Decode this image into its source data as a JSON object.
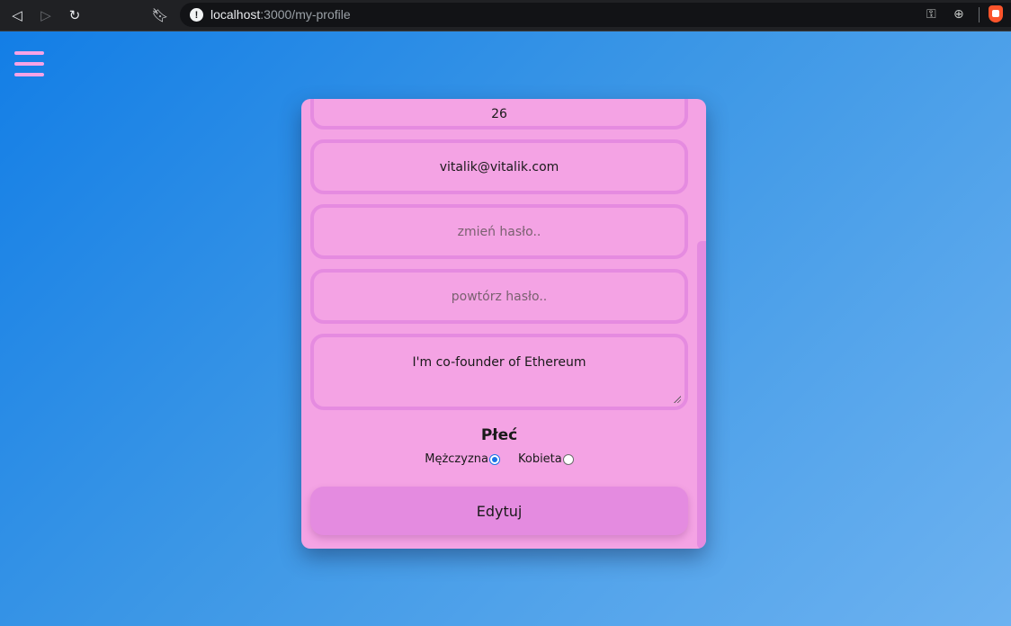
{
  "browser": {
    "url_host": "localhost",
    "url_path": ":3000/my-profile",
    "info_icon": "!"
  },
  "menu": {
    "icon": "hamburger-icon"
  },
  "profile_form": {
    "age_value": "26",
    "email_value": "vitalik@vitalik.com",
    "password_placeholder": "zmień hasło..",
    "repeat_password_placeholder": "powtórz hasło..",
    "bio_value": "I'm co-founder of Ethereum",
    "gender_title": "Płeć",
    "gender_options": [
      {
        "label": "Mężczyzna",
        "checked": true
      },
      {
        "label": "Kobieta",
        "checked": false
      }
    ],
    "submit_label": "Edytuj"
  },
  "colors": {
    "card": "#f4a3e4",
    "field_border": "#e58be0",
    "button": "#e48be0",
    "hamburger": "#f6a3e6",
    "page_gradient_start": "#137ee6",
    "page_gradient_end": "#6db2f0"
  }
}
